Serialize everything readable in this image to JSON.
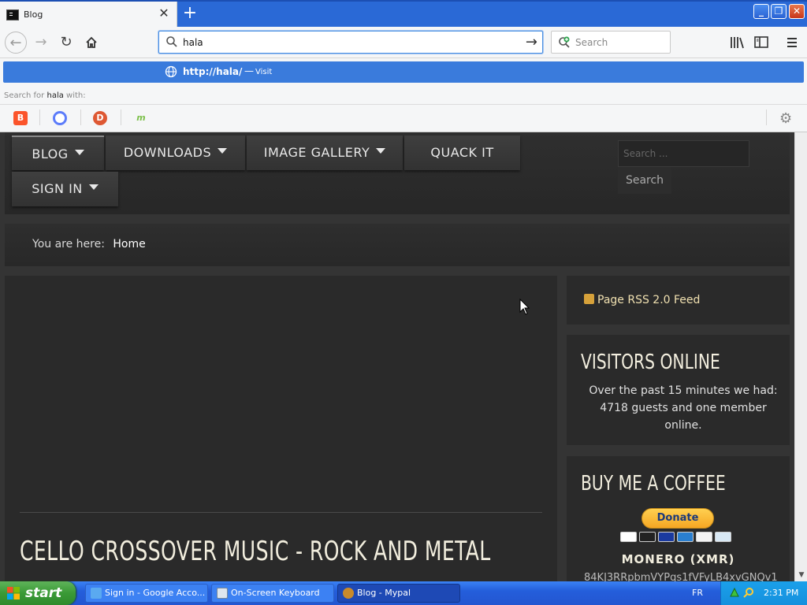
{
  "browser": {
    "tab_title": "Blog",
    "new_tab_symbol": "+",
    "url_value": "hala",
    "search_placeholder": "Search",
    "suggestion": {
      "url": "http://hala/",
      "separator": "—",
      "action": "Visit"
    },
    "search_with_prefix": "Search for",
    "search_with_term": "hala",
    "search_with_suffix": "with:",
    "engines": [
      "brave-icon",
      "qwant-icon",
      "duckduckgo-icon",
      "mojeek-icon"
    ],
    "icons": [
      "back-icon",
      "forward-icon",
      "reload-icon",
      "home-icon",
      "library-icon",
      "sidebar-icon",
      "hamburger-menu-icon",
      "gear-icon"
    ]
  },
  "site": {
    "menu": {
      "blog": "BLOG",
      "downloads": "DOWNLOADS",
      "image_gallery": "IMAGE GALLERY",
      "quack_it": "QUACK IT",
      "sign_in": "SIGN IN"
    },
    "search_placeholder": "Search ...",
    "search_button": "Search",
    "breadcrumb_prefix": "You are here:",
    "breadcrumb_current": "Home",
    "article_title": "CELLO CROSSOVER MUSIC - ROCK AND METAL",
    "rss_link": "Page RSS 2.0 Feed",
    "visitors_heading": "VISITORS ONLINE",
    "visitors_text": "Over the past 15 minutes we had: 4718 guests and one member online.",
    "coffee_heading": "BUY ME A COFFEE",
    "donate_label": "Donate",
    "monero_label": "MONERO (XMR)",
    "monero_address": "84KJ3RRpbmVYPqs1fVFyLB4xvGNQv1"
  },
  "taskbar": {
    "start_label": "start",
    "tasks": [
      {
        "label": "Sign in - Google Acco..."
      },
      {
        "label": "On-Screen Keyboard"
      },
      {
        "label": "Blog - Mypal"
      }
    ],
    "language": "FR",
    "clock": "2:31 PM"
  },
  "colors": {
    "page_bg": "#343434",
    "panel_bg": "#2a2a2a",
    "heading_text": "#f2eede",
    "suggestion_highlight": "#3a7bdc",
    "taskbar_blue": "#245edb",
    "start_green": "#3a9a36"
  }
}
